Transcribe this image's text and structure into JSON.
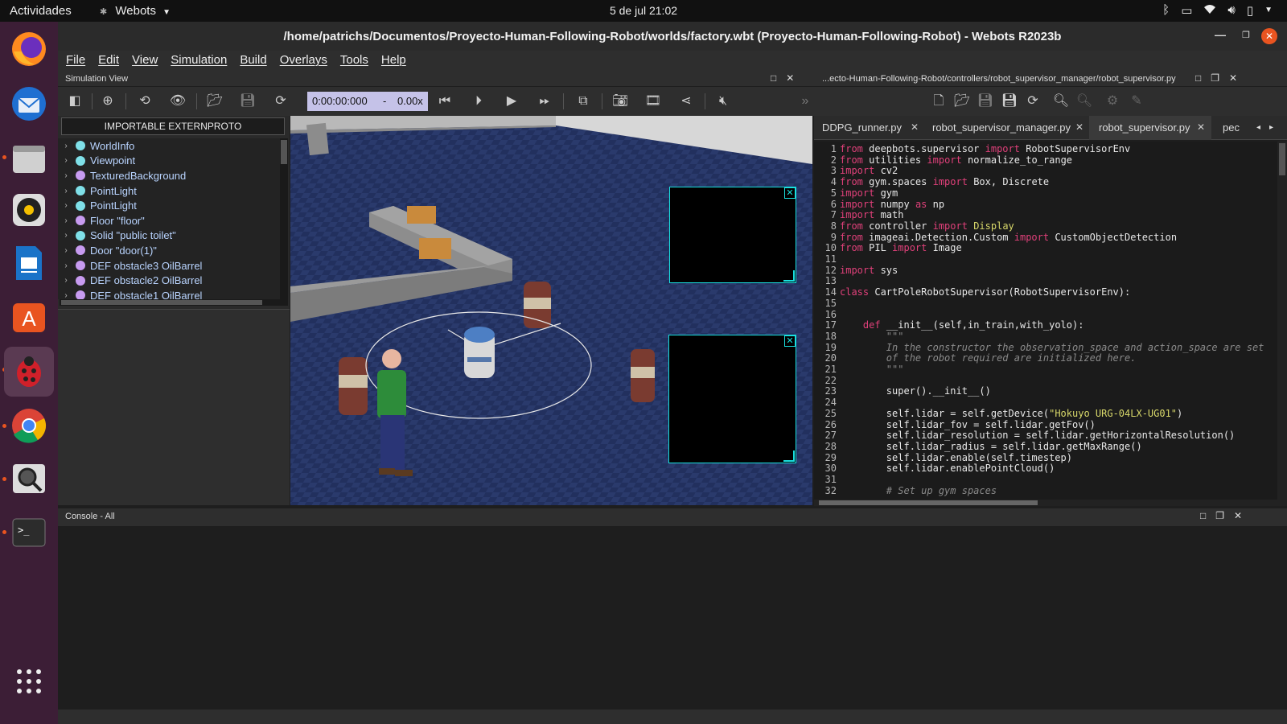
{
  "system": {
    "activities": "Actividades",
    "app_name": "Webots",
    "clock": "5 de jul  21:02"
  },
  "window": {
    "title": "/home/patrichs/Documentos/Proyecto-Human-Following-Robot/worlds/factory.wbt (Proyecto-Human-Following-Robot) - Webots R2023b"
  },
  "menu": [
    "File",
    "Edit",
    "View",
    "Simulation",
    "Build",
    "Overlays",
    "Tools",
    "Help"
  ],
  "sim_view": {
    "header": "Simulation View",
    "time": "0:00:00:000",
    "speed_sep": "-",
    "speed": "0.00x",
    "importable_button": "IMPORTABLE EXTERNPROTO"
  },
  "scene_tree": [
    {
      "label": "WorldInfo",
      "color": "#7fe0e8"
    },
    {
      "label": "Viewpoint",
      "color": "#7fe0e8"
    },
    {
      "label": "TexturedBackground",
      "color": "#c79bf0"
    },
    {
      "label": "PointLight",
      "color": "#7fe0e8"
    },
    {
      "label": "PointLight",
      "color": "#7fe0e8"
    },
    {
      "label": "Floor \"floor\"",
      "color": "#c79bf0"
    },
    {
      "label": "Solid \"public toilet\"",
      "color": "#7fe0e8"
    },
    {
      "label": "Door \"door(1)\"",
      "color": "#c79bf0"
    },
    {
      "label": "DEF obstacle3 OilBarrel",
      "color": "#c79bf0"
    },
    {
      "label": "DEF obstacle2 OilBarrel",
      "color": "#c79bf0"
    },
    {
      "label": "DEF obstacle1 OilBarrel",
      "color": "#c79bf0"
    }
  ],
  "editor": {
    "header": "...ecto-Human-Following-Robot/controllers/robot_supervisor_manager/robot_supervisor.py",
    "tabs": [
      {
        "label": "DDPG_runner.py",
        "active": false
      },
      {
        "label": "robot_supervisor_manager.py",
        "active": false
      },
      {
        "label": "robot_supervisor.py",
        "active": true
      },
      {
        "label": "pec",
        "active": false
      }
    ],
    "lines": [
      [
        [
          "kw",
          "from"
        ],
        [
          "t",
          " deepbots.supervisor "
        ],
        [
          "kw",
          "import"
        ],
        [
          "t",
          " RobotSupervisorEnv"
        ]
      ],
      [
        [
          "kw",
          "from"
        ],
        [
          "t",
          " utilities "
        ],
        [
          "kw",
          "import"
        ],
        [
          "t",
          " normalize_to_range"
        ]
      ],
      [
        [
          "kw",
          "import"
        ],
        [
          "t",
          " cv2"
        ]
      ],
      [
        [
          "kw",
          "from"
        ],
        [
          "t",
          " gym.spaces "
        ],
        [
          "kw",
          "import"
        ],
        [
          "t",
          " Box, Discrete"
        ]
      ],
      [
        [
          "kw",
          "import"
        ],
        [
          "t",
          " gym"
        ]
      ],
      [
        [
          "kw",
          "import"
        ],
        [
          "t",
          " numpy "
        ],
        [
          "kw",
          "as"
        ],
        [
          "t",
          " np"
        ]
      ],
      [
        [
          "kw",
          "import"
        ],
        [
          "t",
          " math"
        ]
      ],
      [
        [
          "kw",
          "from"
        ],
        [
          "t",
          " controller "
        ],
        [
          "kw",
          "import"
        ],
        [
          "cls",
          " Display"
        ]
      ],
      [
        [
          "kw",
          "from"
        ],
        [
          "t",
          " imageai.Detection.Custom "
        ],
        [
          "kw",
          "import"
        ],
        [
          "t",
          " CustomObjectDetection"
        ]
      ],
      [
        [
          "kw",
          "from"
        ],
        [
          "t",
          " PIL "
        ],
        [
          "kw",
          "import"
        ],
        [
          "t",
          " Image"
        ]
      ],
      [],
      [
        [
          "kw",
          "import"
        ],
        [
          "t",
          " sys"
        ]
      ],
      [],
      [
        [
          "kw",
          "class"
        ],
        [
          "t",
          " CartPoleRobotSupervisor(RobotSupervisorEnv):"
        ]
      ],
      [],
      [],
      [
        [
          "t",
          "    "
        ],
        [
          "kw",
          "def"
        ],
        [
          "t",
          " __init__(self,in_train,with_yolo):"
        ]
      ],
      [
        [
          "cm",
          "        \"\"\""
        ]
      ],
      [
        [
          "cm",
          "        In the constructor the observation_space and action_space are set"
        ]
      ],
      [
        [
          "cm",
          "        of the robot required are initialized here."
        ]
      ],
      [
        [
          "cm",
          "        \"\"\""
        ]
      ],
      [],
      [
        [
          "t",
          "        super().__init__()"
        ]
      ],
      [],
      [
        [
          "t",
          "        self.lidar = self.getDevice("
        ],
        [
          "str",
          "\"Hokuyo URG-04LX-UG01\""
        ],
        [
          "t",
          ")"
        ]
      ],
      [
        [
          "t",
          "        self.lidar_fov = self.lidar.getFov()"
        ]
      ],
      [
        [
          "t",
          "        self.lidar_resolution = self.lidar.getHorizontalResolution()"
        ]
      ],
      [
        [
          "t",
          "        self.lidar_radius = self.lidar.getMaxRange()"
        ]
      ],
      [
        [
          "t",
          "        self.lidar.enable(self.timestep)"
        ]
      ],
      [
        [
          "t",
          "        self.lidar.enablePointCloud()"
        ]
      ],
      [],
      [
        [
          "cm",
          "        # Set up gym spaces"
        ]
      ]
    ]
  },
  "console": {
    "header": "Console - All"
  }
}
